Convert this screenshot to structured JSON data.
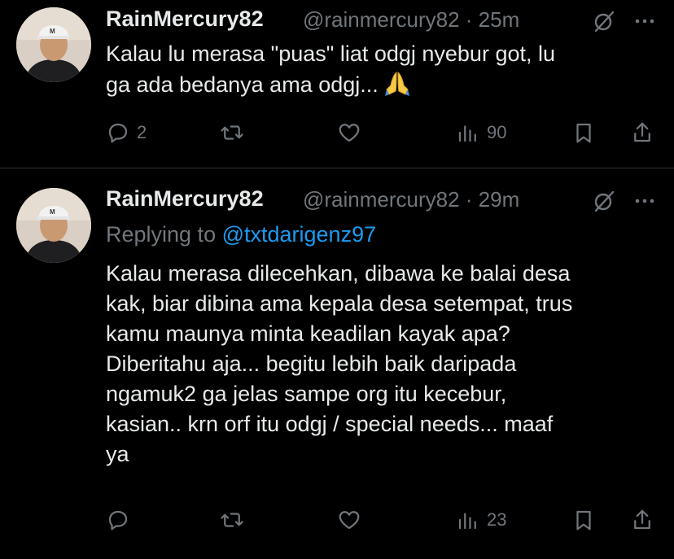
{
  "tweets": [
    {
      "author_name": "RainMercury82",
      "meta": "@rainmercury82 · 25m",
      "text_lines": [
        "Kalau lu merasa \"puas\" liat odgj nyebur got, lu",
        "ga ada bedanya ama odgj..."
      ],
      "emoji": "folded-hands",
      "actions": {
        "replies": "2",
        "retweets": "",
        "likes": "",
        "views": "90"
      }
    },
    {
      "author_name": "RainMercury82",
      "meta": "@rainmercury82 · 29m",
      "replying_prefix": "Replying to ",
      "replying_to": "@txtdarigenz97",
      "text_lines": [
        "Kalau merasa dilecehkan, dibawa ke balai desa",
        "kak, biar dibina ama kepala desa setempat, trus",
        "kamu maunya minta keadilan kayak apa?",
        "Diberitahu aja... begitu lebih baik daripada",
        "ngamuk2 ga jelas sampe org itu kecebur,",
        "kasian.. krn orf itu odgj / special needs... maaf",
        "ya"
      ],
      "actions": {
        "replies": "",
        "retweets": "",
        "likes": "",
        "views": "23"
      }
    }
  ],
  "colors": {
    "background": "#000000",
    "text": "#e7e9ea",
    "muted": "#71767b",
    "link": "#1d9bf0",
    "divider": "#2f3336"
  },
  "icons": [
    "reply-icon",
    "retweet-icon",
    "like-icon",
    "views-icon",
    "bookmark-icon",
    "share-icon",
    "grok-icon",
    "more-icon"
  ]
}
